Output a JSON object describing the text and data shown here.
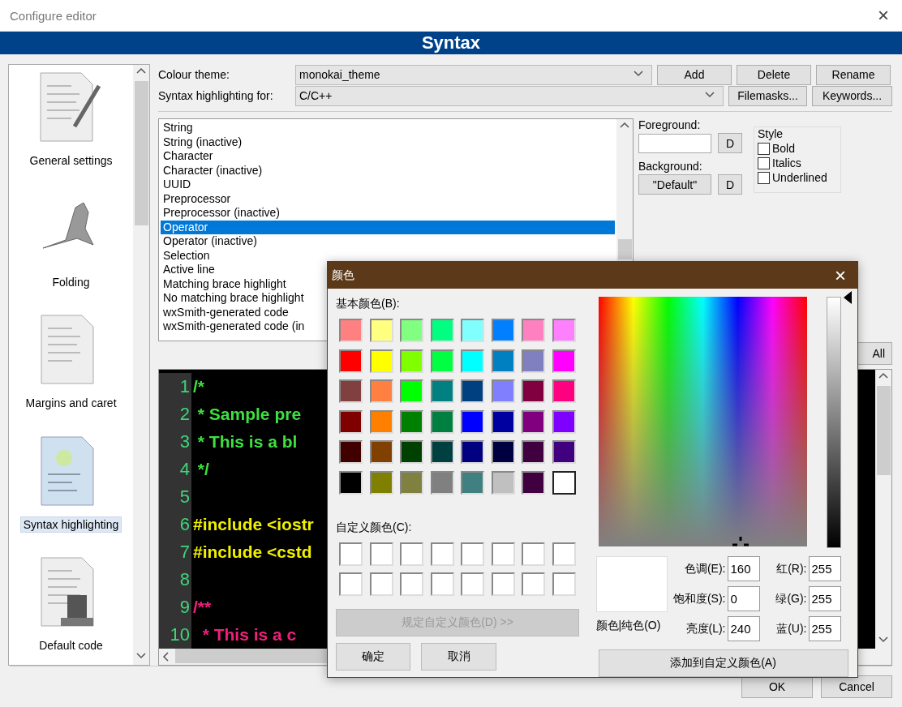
{
  "window": {
    "title": "Configure editor",
    "close": "×"
  },
  "header": {
    "title": "Syntax"
  },
  "sidebar": {
    "items": [
      {
        "label": "General settings",
        "selected": false
      },
      {
        "label": "Folding",
        "selected": false
      },
      {
        "label": "Margins and caret",
        "selected": false
      },
      {
        "label": "Syntax highlighting",
        "selected": true
      },
      {
        "label": "Default code",
        "selected": false
      }
    ]
  },
  "theme": {
    "label": "Colour theme:",
    "value": "monokai_theme",
    "buttons": [
      "Add",
      "Delete",
      "Rename"
    ]
  },
  "language": {
    "label": "Syntax highlighting for:",
    "value": "C/C++",
    "buttons": [
      "Filemasks...",
      "Keywords..."
    ]
  },
  "styles": {
    "items": [
      {
        "label": "String",
        "selected": false
      },
      {
        "label": "String (inactive)",
        "selected": false
      },
      {
        "label": "Character",
        "selected": false
      },
      {
        "label": "Character (inactive)",
        "selected": false
      },
      {
        "label": "UUID",
        "selected": false
      },
      {
        "label": "Preprocessor",
        "selected": false
      },
      {
        "label": "Preprocessor (inactive)",
        "selected": false
      },
      {
        "label": "Operator",
        "selected": true
      },
      {
        "label": "Operator (inactive)",
        "selected": false
      },
      {
        "label": "Selection",
        "selected": false
      },
      {
        "label": "Active line",
        "selected": false
      },
      {
        "label": "Matching brace highlight",
        "selected": false
      },
      {
        "label": "No matching brace highlight",
        "selected": false
      },
      {
        "label": "wxSmith-generated code",
        "selected": false
      },
      {
        "label": "wxSmith-generated code (in",
        "selected": false
      }
    ]
  },
  "foreground": {
    "label": "Foreground:",
    "reset": "D"
  },
  "background": {
    "label": "Background:",
    "value": "\"Default\"",
    "reset": "D"
  },
  "style_group": {
    "title": "Style",
    "options": [
      {
        "label": "Bold",
        "checked": false
      },
      {
        "label": "Italics",
        "checked": false
      },
      {
        "label": "Underlined",
        "checked": false
      }
    ]
  },
  "partial_button": {
    "label": "All"
  },
  "code": {
    "lines": [
      {
        "number": "1",
        "text": "/*",
        "kind": "comment"
      },
      {
        "number": "2",
        "text": " * Sample pre",
        "kind": "comment"
      },
      {
        "number": "3",
        "text": " * This is a bl",
        "kind": "comment"
      },
      {
        "number": "4",
        "text": " */",
        "kind": "comment"
      },
      {
        "number": "5"
      },
      {
        "number": "6",
        "text": "#include <iostr",
        "kind": "preprocessor"
      },
      {
        "number": "7",
        "text": "#include <cstd",
        "kind": "preprocessor"
      },
      {
        "number": "8"
      },
      {
        "number": "9",
        "text": "/**",
        "kind": "doc"
      },
      {
        "number": "10",
        "text": "  * This is a c",
        "kind": "doc"
      }
    ]
  },
  "footer": {
    "buttons": [
      "OK",
      "Cancel"
    ]
  },
  "color_dialog": {
    "title": "颜色",
    "close": "×",
    "basic_label": "基本颜色(B):",
    "basic_colors": [
      {
        "color": "#ff8080",
        "selected": false
      },
      {
        "color": "#ffff80",
        "selected": false
      },
      {
        "color": "#80ff80",
        "selected": false
      },
      {
        "color": "#00ff80",
        "selected": false
      },
      {
        "color": "#80ffff",
        "selected": false
      },
      {
        "color": "#0080ff",
        "selected": false
      },
      {
        "color": "#ff80c0",
        "selected": false
      },
      {
        "color": "#ff80ff",
        "selected": false
      },
      {
        "color": "#ff0000",
        "selected": false
      },
      {
        "color": "#ffff00",
        "selected": false
      },
      {
        "color": "#80ff00",
        "selected": false
      },
      {
        "color": "#00ff40",
        "selected": false
      },
      {
        "color": "#00ffff",
        "selected": false
      },
      {
        "color": "#0080c0",
        "selected": false
      },
      {
        "color": "#8080c0",
        "selected": false
      },
      {
        "color": "#ff00ff",
        "selected": false
      },
      {
        "color": "#804040",
        "selected": false
      },
      {
        "color": "#ff8040",
        "selected": false
      },
      {
        "color": "#00ff00",
        "selected": false
      },
      {
        "color": "#008080",
        "selected": false
      },
      {
        "color": "#004080",
        "selected": false
      },
      {
        "color": "#8080ff",
        "selected": false
      },
      {
        "color": "#800040",
        "selected": false
      },
      {
        "color": "#ff0080",
        "selected": false
      },
      {
        "color": "#800000",
        "selected": false
      },
      {
        "color": "#ff8000",
        "selected": false
      },
      {
        "color": "#008000",
        "selected": false
      },
      {
        "color": "#008040",
        "selected": false
      },
      {
        "color": "#0000ff",
        "selected": false
      },
      {
        "color": "#0000a0",
        "selected": false
      },
      {
        "color": "#800080",
        "selected": false
      },
      {
        "color": "#8000ff",
        "selected": false
      },
      {
        "color": "#400000",
        "selected": false
      },
      {
        "color": "#804000",
        "selected": false
      },
      {
        "color": "#004000",
        "selected": false
      },
      {
        "color": "#004040",
        "selected": false
      },
      {
        "color": "#000080",
        "selected": false
      },
      {
        "color": "#000040",
        "selected": false
      },
      {
        "color": "#400040",
        "selected": false
      },
      {
        "color": "#400080",
        "selected": false
      },
      {
        "color": "#000000",
        "selected": false
      },
      {
        "color": "#808000",
        "selected": false
      },
      {
        "color": "#808040",
        "selected": false
      },
      {
        "color": "#808080",
        "selected": false
      },
      {
        "color": "#408080",
        "selected": false
      },
      {
        "color": "#c0c0c0",
        "selected": false
      },
      {
        "color": "#400040",
        "selected": false
      },
      {
        "color": "#ffffff",
        "selected": true
      }
    ],
    "custom_label": "自定义颜色(C):",
    "custom_colors": [
      {
        "color": "#ffffff"
      },
      {
        "color": "#ffffff"
      },
      {
        "color": "#ffffff"
      },
      {
        "color": "#ffffff"
      },
      {
        "color": "#ffffff"
      },
      {
        "color": "#ffffff"
      },
      {
        "color": "#ffffff"
      },
      {
        "color": "#ffffff"
      },
      {
        "color": "#ffffff"
      },
      {
        "color": "#ffffff"
      },
      {
        "color": "#ffffff"
      },
      {
        "color": "#ffffff"
      },
      {
        "color": "#ffffff"
      },
      {
        "color": "#ffffff"
      },
      {
        "color": "#ffffff"
      },
      {
        "color": "#ffffff"
      }
    ],
    "define_button": {
      "label": "规定自定义颜色(D) >>",
      "disabled": true
    },
    "ok": "确定",
    "cancel": "取消",
    "luminance": {
      "level": 1
    },
    "preview_label": "颜色|纯色(O)",
    "fields": [
      {
        "label": "色调(E):",
        "value": "160"
      },
      {
        "label": "红(R):",
        "value": "255"
      },
      {
        "label": "饱和度(S):",
        "value": "0"
      },
      {
        "label": "绿(G):",
        "value": "255"
      },
      {
        "label": "亮度(L):",
        "value": "240"
      },
      {
        "label": "蓝(U):",
        "value": "255"
      }
    ],
    "add_button": "添加到自定义颜色(A)"
  }
}
